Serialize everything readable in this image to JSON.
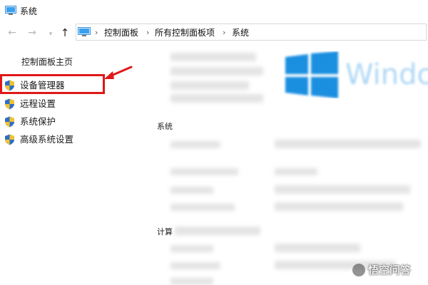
{
  "window": {
    "title": "系统"
  },
  "address": {
    "crumbs": [
      "控制面板",
      "所有控制面板项",
      "系统"
    ]
  },
  "sidebar": {
    "home_link": "控制面板主页",
    "items": [
      {
        "label": "设备管理器",
        "icon": "uac-shield-icon"
      },
      {
        "label": "远程设置",
        "icon": "uac-shield-icon"
      },
      {
        "label": "系统保护",
        "icon": "uac-shield-icon"
      },
      {
        "label": "高级系统设置",
        "icon": "uac-shield-icon"
      }
    ]
  },
  "main": {
    "section_system_fragment": "系统",
    "section_computer_fragment": "计算"
  },
  "watermark": {
    "text": "悟空问答"
  },
  "colors": {
    "highlight": "#e01818",
    "windows_blue": "#1a8fe0",
    "shield_blue": "#2d6fc8",
    "shield_yellow": "#f1c232"
  }
}
